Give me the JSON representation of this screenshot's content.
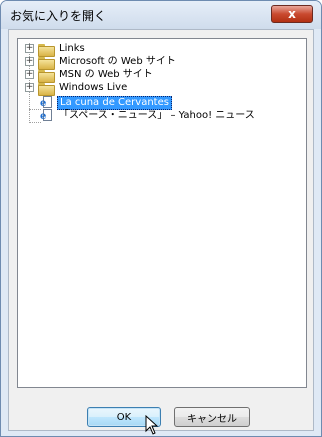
{
  "window": {
    "title": "お気に入りを開く",
    "close_label": "x"
  },
  "tree": {
    "items": [
      {
        "label": "Links",
        "type": "folder",
        "expander": "+"
      },
      {
        "label": "Microsoft の Web サイト",
        "type": "folder",
        "expander": "+"
      },
      {
        "label": "MSN の Web サイト",
        "type": "folder",
        "expander": "+"
      },
      {
        "label": "Windows Live",
        "type": "folder",
        "expander": "+"
      },
      {
        "label": "La cuna de Cervantes",
        "type": "page",
        "selected": true
      },
      {
        "label": "「スペース・ニュース」 – Yahoo! ニュース",
        "type": "page"
      }
    ]
  },
  "buttons": {
    "ok_label": "OK",
    "cancel_label": "キャンセル"
  }
}
